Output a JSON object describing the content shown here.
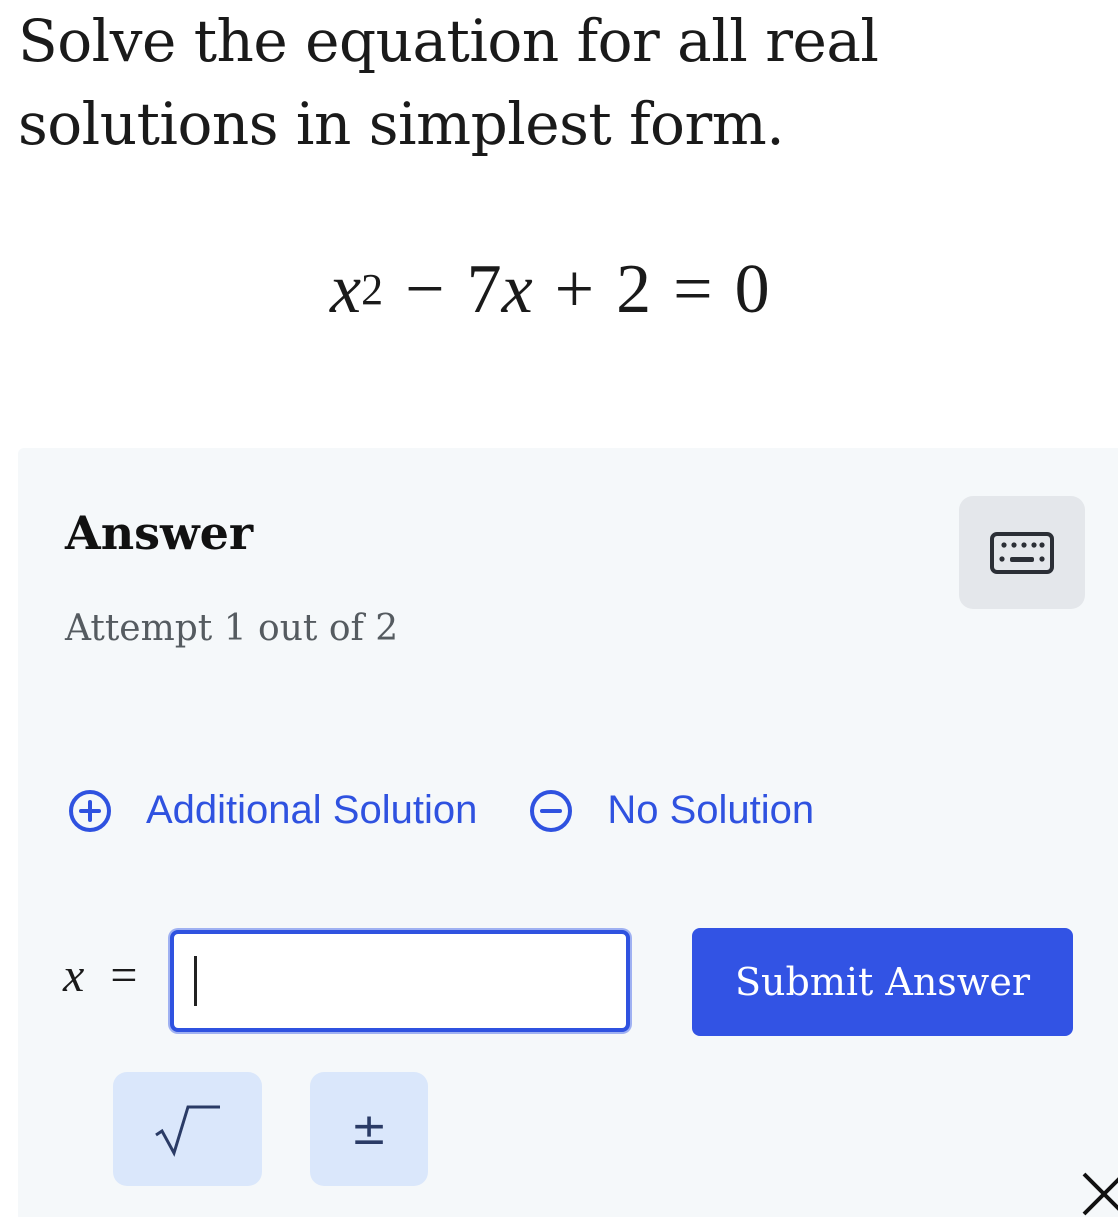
{
  "question": {
    "text": "Solve the equation for all real solutions in simplest form."
  },
  "equation": {
    "var": "x",
    "exponent": "2",
    "op1": "−",
    "term2": "7",
    "var2": "x",
    "op2": "+",
    "constant": "2",
    "equals": "=",
    "rhs": "0"
  },
  "answer_panel": {
    "heading": "Answer",
    "attempt": "Attempt 1 out of 2",
    "keyboard_icon": "keyboard-icon",
    "additional_solution": {
      "label": "Additional Solution",
      "icon": "plus-circle-icon"
    },
    "no_solution": {
      "label": "No Solution",
      "icon": "minus-circle-icon"
    },
    "input_label_var": "x",
    "input_label_eq": "=",
    "input_value": "",
    "submit_label": "Submit Answer",
    "tools": {
      "sqrt_icon": "square-root-icon",
      "plus_minus": "±"
    },
    "close_icon": "close-icon"
  },
  "colors": {
    "accent": "#2f52e0",
    "panel_bg": "#f5f8fa",
    "tool_bg": "#dae7fb",
    "keyboard_bg": "#e4e7eb"
  }
}
